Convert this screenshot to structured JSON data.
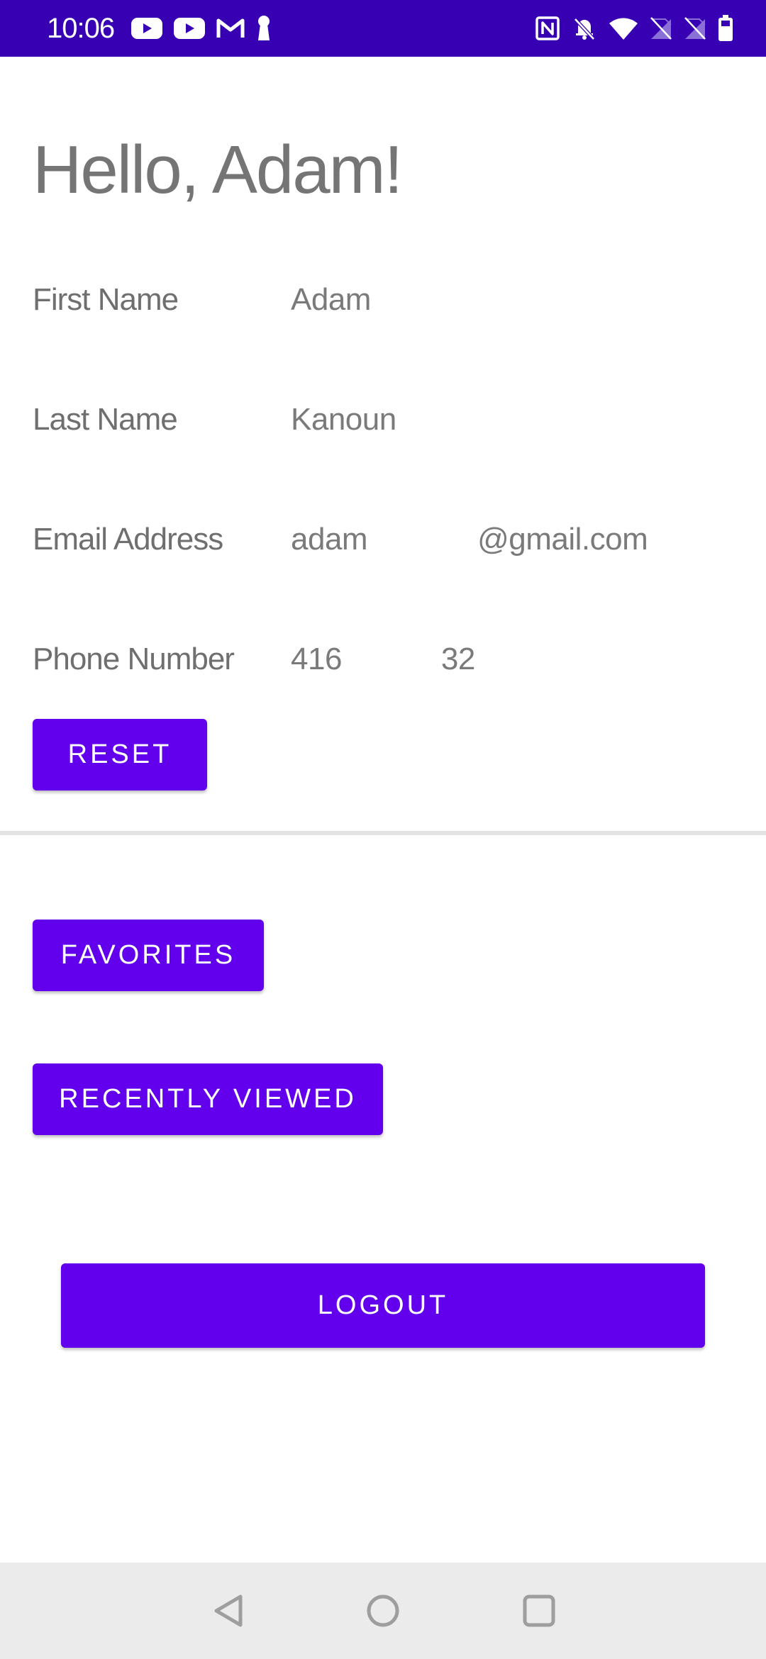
{
  "status_bar": {
    "time": "10:06",
    "left_icons": [
      "youtube-icon",
      "youtube-icon",
      "gmail-icon",
      "keyhole-icon"
    ],
    "right_icons": [
      "nfc-icon",
      "bell-off-icon",
      "wifi-icon",
      "no-sim-icon",
      "no-sim-icon",
      "battery-icon"
    ],
    "background": "#3700b3"
  },
  "profile": {
    "greeting": "Hello, Adam!",
    "fields": [
      {
        "label": "First Name",
        "value": "Adam"
      },
      {
        "label": "Last Name",
        "value": "Kanoun"
      },
      {
        "label": "Email Address",
        "value_start": "adam",
        "value_end": "@gmail.com"
      },
      {
        "label": "Phone Number",
        "value_start": "416",
        "value_end": "32"
      }
    ]
  },
  "buttons": {
    "reset": "RESET",
    "favorites": "FAVORITES",
    "recently_viewed": "RECENTLY VIEWED",
    "logout": "LOGOUT"
  },
  "nav_bar": {
    "icons": [
      "back-icon",
      "home-icon",
      "recents-icon"
    ]
  },
  "colors": {
    "primary": "#6200ee",
    "primary_dark": "#3700b3",
    "text_gray": "#757575",
    "divider": "#e3e3e3",
    "nav_bg": "#ebebeb"
  }
}
